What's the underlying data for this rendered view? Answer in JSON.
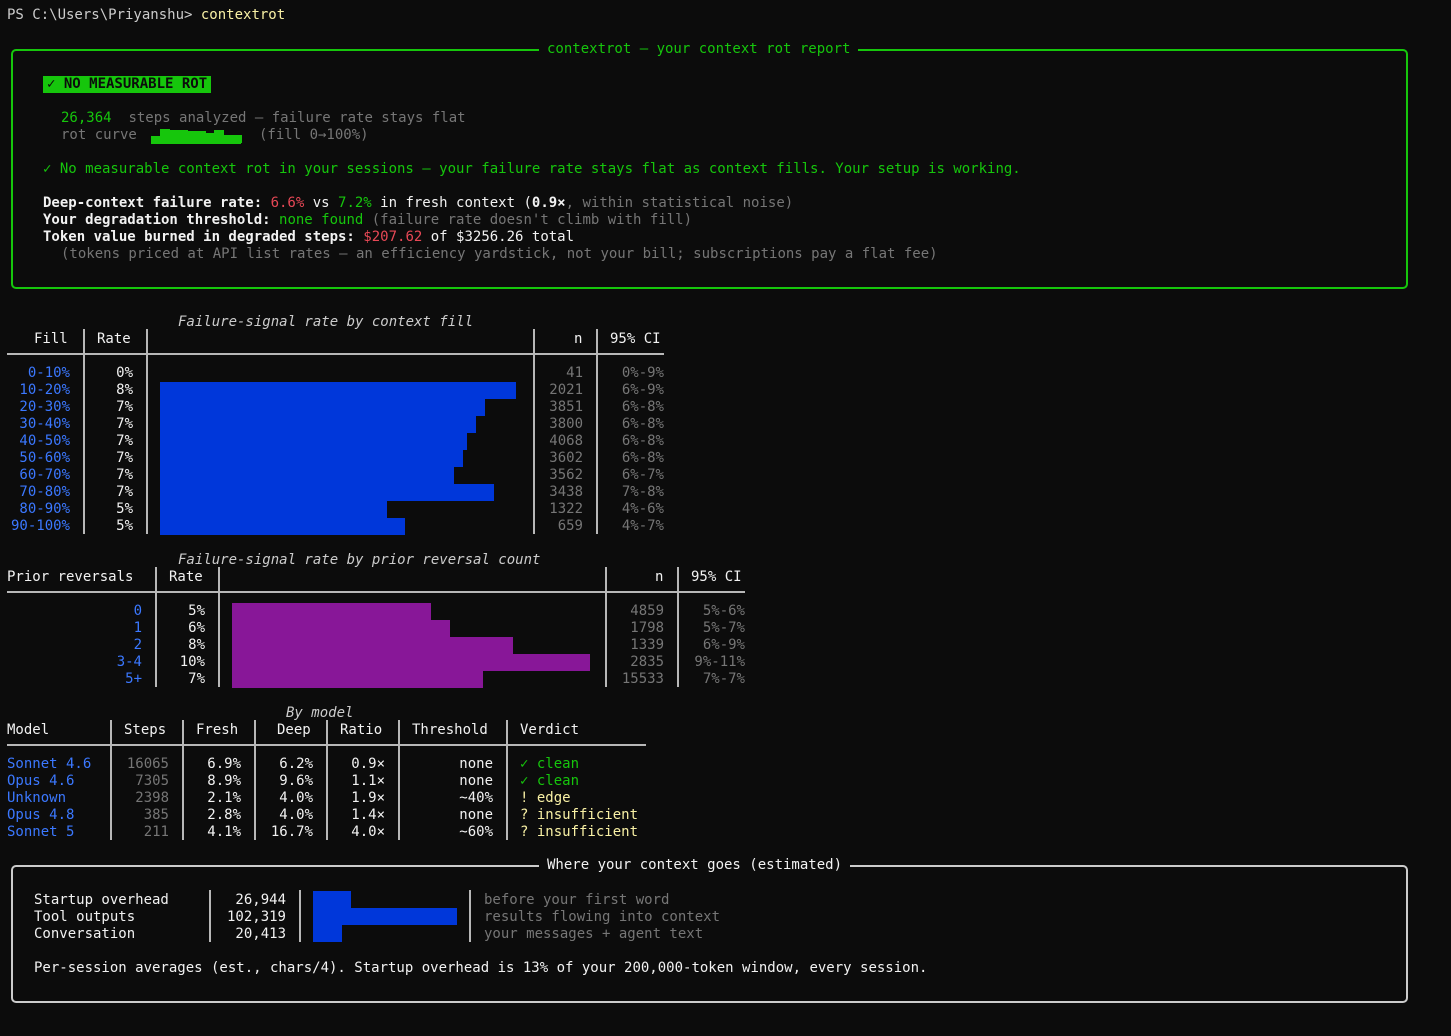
{
  "terminal": {
    "prompt": "PS C:\\Users\\Priyanshu> ",
    "command": "contextrot"
  },
  "report": {
    "title": "contextrot — your context rot report",
    "badge": "✓ NO MEASURABLE ROT",
    "steps_count": "26,364",
    "steps_text": "steps analyzed — failure rate stays flat",
    "rot_curve_label": "rot curve",
    "rot_curve_note": "(fill 0→100%)",
    "rot_curve_levels": [
      0.5,
      1,
      0.9,
      0.9,
      0.85,
      0.85,
      0.75,
      0.9,
      0.6,
      0.6
    ],
    "summary": "✓ No measurable context rot in your sessions — your failure rate stays flat as context fills. Your setup is working.",
    "deep_label": "Deep-context failure rate: ",
    "deep_value": "6.6%",
    "vs": " vs ",
    "fresh_value": "7.2%",
    "fresh_label": " in fresh context (",
    "ratio": "0.9×",
    "noise": ", within statistical noise)",
    "threshold_label": "Your degradation threshold: ",
    "threshold_value": "none found",
    "threshold_note": " (failure rate doesn't climb with fill)",
    "burned_label": "Token value burned in degraded steps: ",
    "burned_value": "$207.62",
    "burned_total": " of $3256.26 total",
    "pricing_note": "(tokens priced at API list rates — an efficiency yardstick, not your bill; subscriptions pay a flat fee)"
  },
  "fill_table": {
    "title": "Failure-signal rate by context fill",
    "headers": {
      "fill": "Fill",
      "rate": "Rate",
      "n": "n",
      "ci": "95% CI"
    },
    "color": "#0037da",
    "rows": [
      {
        "fill": "0-10%",
        "rate": "0%",
        "value": 0,
        "n": "41",
        "ci": "0%-9%"
      },
      {
        "fill": "10-20%",
        "rate": "8%",
        "value": 8,
        "n": "2021",
        "ci": "6%-9%"
      },
      {
        "fill": "20-30%",
        "rate": "7%",
        "value": 7.3,
        "n": "3851",
        "ci": "6%-8%"
      },
      {
        "fill": "30-40%",
        "rate": "7%",
        "value": 7.1,
        "n": "3800",
        "ci": "6%-8%"
      },
      {
        "fill": "40-50%",
        "rate": "7%",
        "value": 6.9,
        "n": "4068",
        "ci": "6%-8%"
      },
      {
        "fill": "50-60%",
        "rate": "7%",
        "value": 6.8,
        "n": "3602",
        "ci": "6%-8%"
      },
      {
        "fill": "60-70%",
        "rate": "7%",
        "value": 6.6,
        "n": "3562",
        "ci": "6%-7%"
      },
      {
        "fill": "70-80%",
        "rate": "7%",
        "value": 7.5,
        "n": "3438",
        "ci": "7%-8%"
      },
      {
        "fill": "80-90%",
        "rate": "5%",
        "value": 5.1,
        "n": "1322",
        "ci": "4%-6%"
      },
      {
        "fill": "90-100%",
        "rate": "5%",
        "value": 5.5,
        "n": "659",
        "ci": "4%-7%"
      }
    ]
  },
  "reversal_table": {
    "title": "Failure-signal rate by prior reversal count",
    "headers": {
      "prior": "Prior reversals",
      "rate": "Rate",
      "n": "n",
      "ci": "95% CI"
    },
    "color": "#881798",
    "rows": [
      {
        "prior": "0",
        "rate": "5%",
        "value": 5.4,
        "n": "4859",
        "ci": "5%-6%"
      },
      {
        "prior": "1",
        "rate": "6%",
        "value": 5.9,
        "n": "1798",
        "ci": "5%-7%"
      },
      {
        "prior": "2",
        "rate": "8%",
        "value": 7.6,
        "n": "1339",
        "ci": "6%-9%"
      },
      {
        "prior": "3-4",
        "rate": "10%",
        "value": 9.7,
        "n": "2835",
        "ci": "9%-11%"
      },
      {
        "prior": "5+",
        "rate": "7%",
        "value": 6.8,
        "n": "15533",
        "ci": "7%-7%"
      }
    ]
  },
  "model_table": {
    "title": "By model",
    "headers": {
      "model": "Model",
      "steps": "Steps",
      "fresh": "Fresh",
      "deep": "Deep",
      "ratio": "Ratio",
      "threshold": "Threshold",
      "verdict": "Verdict"
    },
    "rows": [
      {
        "model": "Sonnet 4.6",
        "steps": "16065",
        "fresh": "6.9%",
        "deep": "6.2%",
        "ratio": "0.9×",
        "threshold": "none",
        "verdict": "✓ clean",
        "verdict_color": "#16c60c"
      },
      {
        "model": "Opus 4.6",
        "steps": "7305",
        "fresh": "8.9%",
        "deep": "9.6%",
        "ratio": "1.1×",
        "threshold": "none",
        "verdict": "✓ clean",
        "verdict_color": "#16c60c"
      },
      {
        "model": "Unknown",
        "steps": "2398",
        "fresh": "2.1%",
        "deep": "4.0%",
        "ratio": "1.9×",
        "threshold": "~40%",
        "verdict": "! edge",
        "verdict_color": "#f9f1a5"
      },
      {
        "model": "Opus 4.8",
        "steps": "385",
        "fresh": "2.8%",
        "deep": "4.0%",
        "ratio": "1.4×",
        "threshold": "none",
        "verdict": "? insufficient",
        "verdict_color": "#f9f1a5"
      },
      {
        "model": "Sonnet 5",
        "steps": "211",
        "fresh": "4.1%",
        "deep": "16.7%",
        "ratio": "4.0×",
        "threshold": "~60%",
        "verdict": "? insufficient",
        "verdict_color": "#f9f1a5"
      }
    ]
  },
  "context_box": {
    "title": "Where your context goes (estimated)",
    "color": "#0037da",
    "rows": [
      {
        "label": "Startup overhead",
        "value": "26,944",
        "tokens": 26944,
        "note": "before your first word"
      },
      {
        "label": "Tool outputs",
        "value": "102,319",
        "tokens": 102319,
        "note": "results flowing into context"
      },
      {
        "label": "Conversation",
        "value": "20,413",
        "tokens": 20413,
        "note": "your messages + agent text"
      }
    ],
    "footer": "Per-session averages (est., chars/4). Startup overhead is 13% of your 200,000-token window, every session."
  }
}
